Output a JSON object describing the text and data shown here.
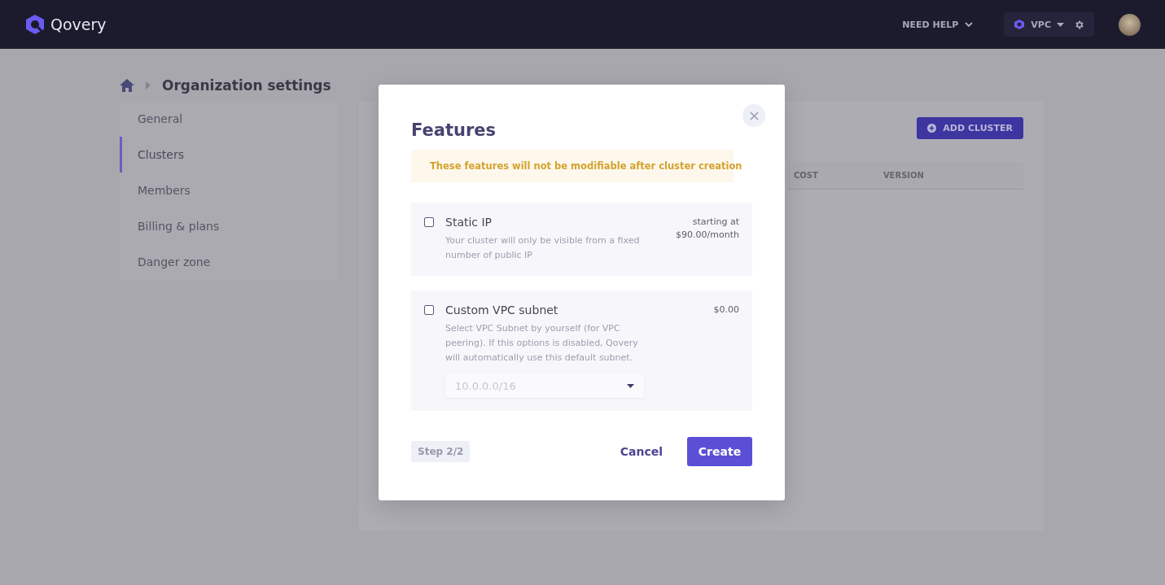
{
  "topbar": {
    "brand": "Qovery",
    "help_menu": "NEED HELP",
    "org_menu": "VPC"
  },
  "breadcrumb": {
    "title": "Organization settings"
  },
  "sidebar": {
    "items": [
      {
        "label": "General",
        "selected": false
      },
      {
        "label": "Clusters",
        "selected": true
      },
      {
        "label": "Members",
        "selected": false
      },
      {
        "label": "Billing & plans",
        "selected": false
      },
      {
        "label": "Danger zone",
        "selected": false
      }
    ]
  },
  "clusters_panel": {
    "add_button": "ADD CLUSTER",
    "columns": [
      "COST",
      "VERSION"
    ]
  },
  "dialog": {
    "title": "Features",
    "warning": "These features will not be modifiable after cluster creation",
    "features": [
      {
        "kind": "plain",
        "name": "Static IP",
        "checked": false,
        "description": "Your cluster will only be visible from a fixed number of public IP",
        "price_note": "starting at",
        "price": "$90.00/month"
      },
      {
        "kind": "subnet",
        "name": "Custom VPC subnet",
        "checked": false,
        "description": "Select VPC Subnet by yourself (for VPC peering). If this options is disabled, Qovery will automatically use this default subnet.",
        "price": "$0.00",
        "subnet": {
          "value": "10.0.0.0/16"
        }
      }
    ],
    "step": "Step 2/2",
    "cancel": "Cancel",
    "create": "Create"
  }
}
